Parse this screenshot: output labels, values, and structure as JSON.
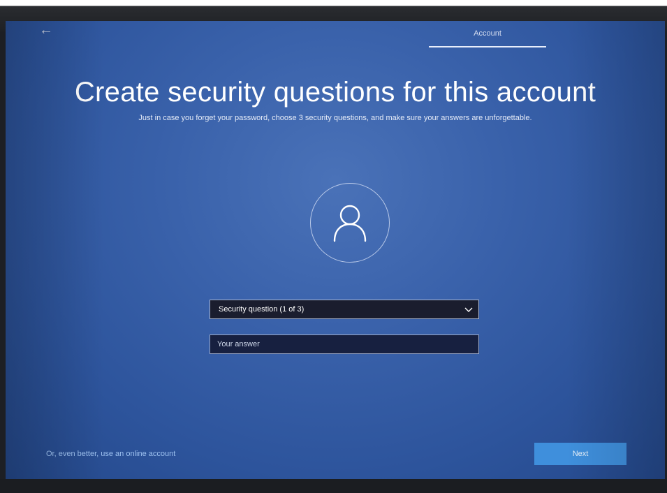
{
  "nav": {
    "back_icon": "back-arrow-icon",
    "back_glyph": "←",
    "tab_label": "Account"
  },
  "main": {
    "title": "Create security questions for this account",
    "subtitle": "Just in case you forget your password, choose 3 security questions, and make sure your answers are unforgettable.",
    "avatar_icon": "user-icon"
  },
  "form": {
    "question_select_value": "Security question (1 of 3)",
    "answer_placeholder": "Your answer"
  },
  "footer": {
    "online_account_link": "Or, even better, use an online account",
    "next_label": "Next"
  },
  "colors": {
    "background": "#2d549c",
    "accent_button": "#3f8fdc",
    "link": "#9ec2f0"
  }
}
